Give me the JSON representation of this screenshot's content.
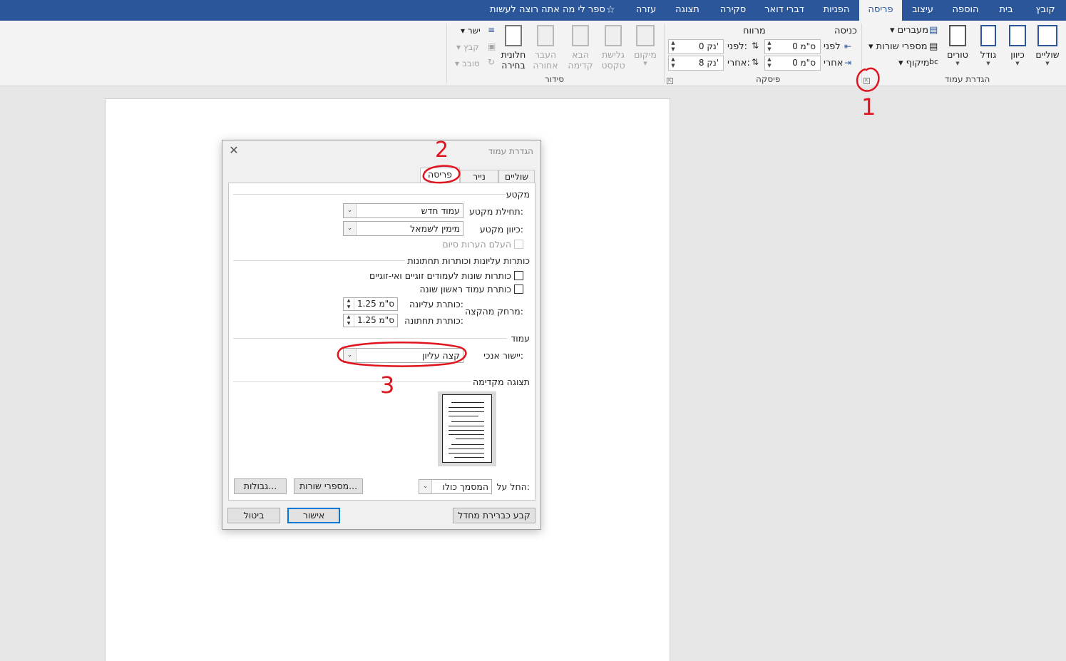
{
  "ribbon_tabs": [
    "קובץ",
    "בית",
    "הוספה",
    "עיצוב",
    "פריסה",
    "הפניות",
    "דברי דואר",
    "סקירה",
    "תצוגה",
    "עזרה"
  ],
  "active_tab": "פריסה",
  "tell_me": "ספר לי מה אתה רוצה לעשות",
  "page_setup_group": {
    "label": "הגדרת עמוד",
    "margins": "שוליים",
    "orientation": "כיוון",
    "size": "גודל",
    "columns": "טורים",
    "breaks": "מעברים",
    "line_numbers": "מספרי שורות",
    "hyphenation": "מיקוף"
  },
  "paragraph_group": {
    "label": "פיסקה",
    "indent_title": "כניסה",
    "indent_before_label": "לפני",
    "indent_before": "0 ס\"מ",
    "indent_after_label": "אחרי",
    "indent_after": "0 ס\"מ",
    "spacing_title": "מרווח",
    "spacing_before_label": "לפני:",
    "spacing_before": "0 נק'",
    "spacing_after_label": "אחרי:",
    "spacing_after": "8 נק'"
  },
  "arrange_group": {
    "label": "סידור",
    "position": "מיקום",
    "wrap_1": "גלישת",
    "wrap_2": "טקסט",
    "forward_1": "הבא",
    "forward_2": "קדימה",
    "backward_1": "העבר",
    "backward_2": "אחורה",
    "selection_1": "חלונית",
    "selection_2": "בחירה",
    "align": "ישר",
    "group": "קבץ",
    "rotate": "סובב"
  },
  "dialog": {
    "title": "הגדרת עמוד",
    "tabs": [
      "שוליים",
      "נייר",
      "פריסה"
    ],
    "active_tab": "פריסה",
    "section_heading": "מקטע",
    "section_start_label": "תחילת מקטע:",
    "section_start_value": "עמוד חדש",
    "section_direction_label": "כיוון מקטע:",
    "section_direction_value": "מימין לשמאל",
    "suppress_endnotes": "העלם הערות סיום",
    "headers_heading": "כותרות עליונות וכותרות תחתונות",
    "odd_even": "כותרות שונות לעמודים זוגיים ואי-זוגיים",
    "first_page": "כותרת עמוד ראשון שונה",
    "from_edge_label": "מרחק מהקצה:",
    "header_label": "כותרת עליונה:",
    "header_value": "1.25  ס\"מ",
    "footer_label": "כותרת תחתונה:",
    "footer_value": "1.25  ס\"מ",
    "page_heading": "עמוד",
    "vertical_alignment_label": "יישור אנכי:",
    "vertical_alignment_value": "קצה עליון",
    "preview_heading": "תצוגה מקדימה",
    "apply_to_label": "החל על:",
    "apply_to_value": "המסמך כולו",
    "line_numbers_button": "מספרי שורות...",
    "borders_button": "גבולות...",
    "set_default_button": "קבע כברירת מחדל",
    "ok_button": "אישור",
    "cancel_button": "ביטול"
  },
  "annotations": [
    "1",
    "2",
    "3"
  ],
  "colors": {
    "accent": "#2b579a",
    "annotation": "#e0141e",
    "focus": "#0078d7"
  }
}
